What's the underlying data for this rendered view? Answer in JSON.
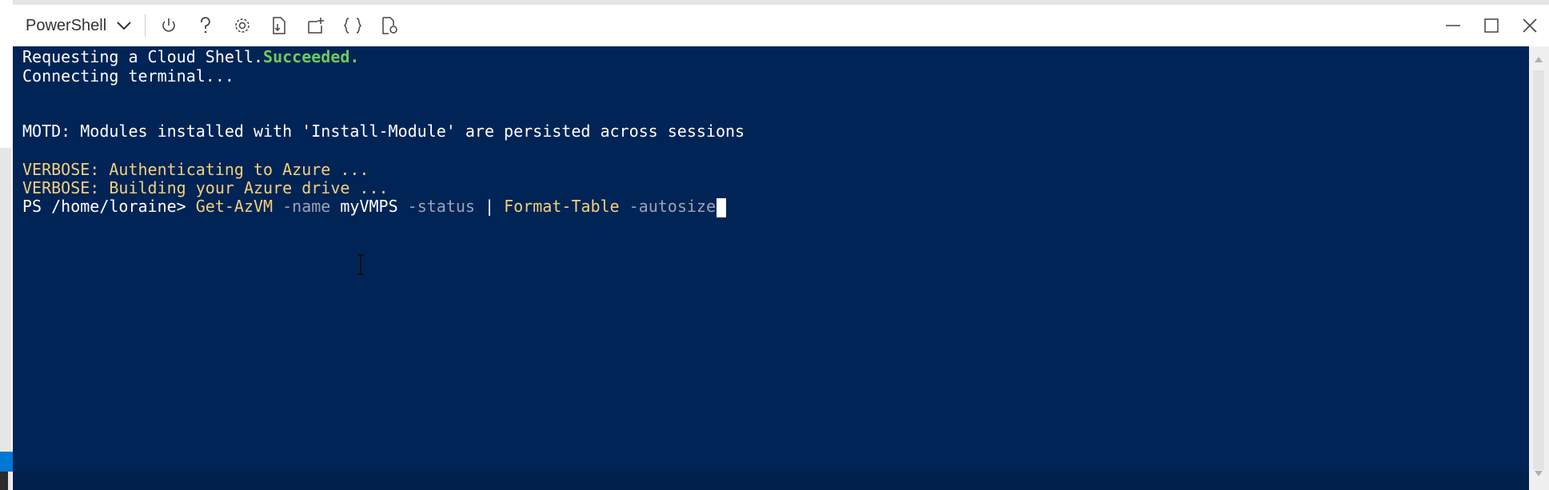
{
  "toolbar": {
    "shell_selector": "PowerShell",
    "icons": [
      "power-icon",
      "help-icon",
      "settings-icon",
      "upload-download-icon",
      "new-session-icon",
      "editor-braces-icon",
      "web-preview-icon"
    ],
    "window_controls": [
      "minimize-icon",
      "maximize-icon",
      "close-icon"
    ]
  },
  "terminal": {
    "line1": {
      "text": "Requesting a Cloud Shell.",
      "status": "Succeeded."
    },
    "line2": "Connecting terminal...",
    "line3": "MOTD: Modules installed with 'Install-Module' are persisted across sessions",
    "line4": "VERBOSE: Authenticating to Azure ...",
    "line5": "VERBOSE: Building your Azure drive ...",
    "prompt": {
      "ps": "PS /home/loraine> ",
      "cmd1": "Get-AzVM",
      "param1": " -name ",
      "arg1": "myVMPS",
      "param2": " -status ",
      "pipe": "| ",
      "cmd2": "Format-Table",
      "param3": " -autosize"
    }
  },
  "colors": {
    "terminal_bg": "#012456",
    "success": "#6ecb5a",
    "verbose": "#f0d07a",
    "parameter": "#9aa3b5",
    "text": "#ffffff"
  }
}
